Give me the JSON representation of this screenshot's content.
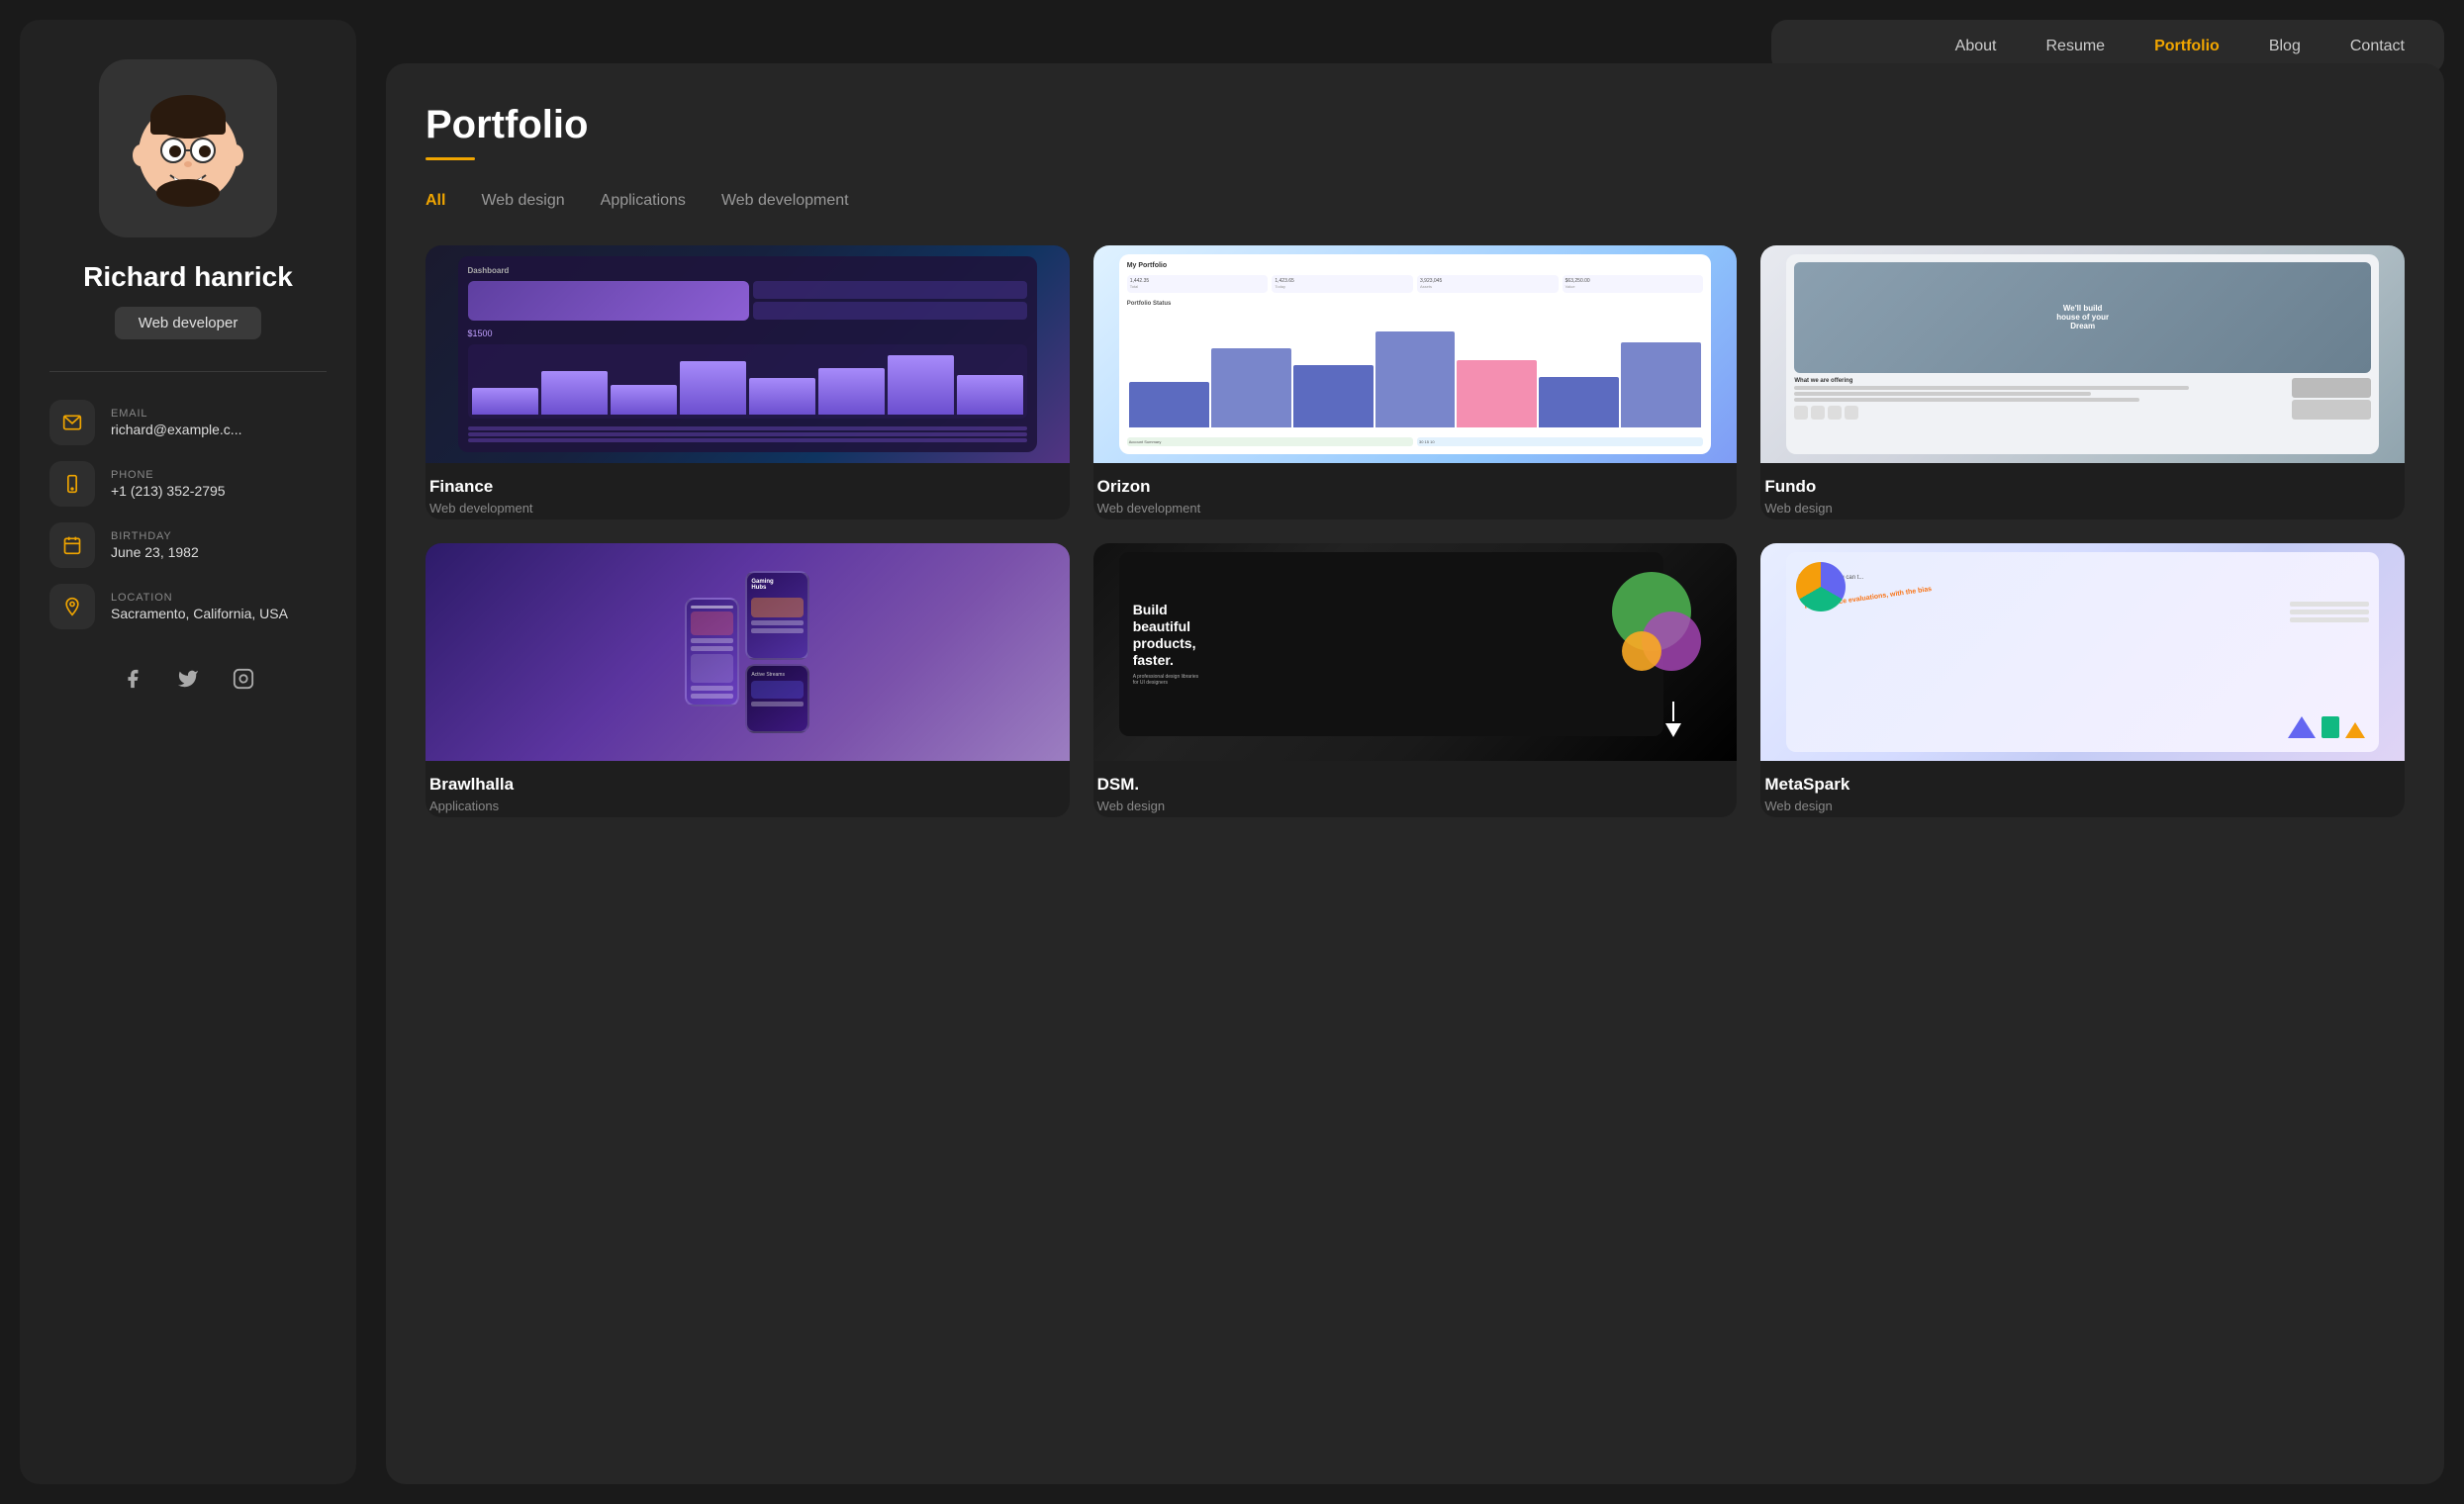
{
  "sidebar": {
    "name": "Richard hanrick",
    "role": "Web developer",
    "avatar_emoji": "🧑‍💻",
    "contacts": [
      {
        "label": "EMAIL",
        "value": "richard@example.c...",
        "icon": "email"
      },
      {
        "label": "PHONE",
        "value": "+1 (213) 352-2795",
        "icon": "phone"
      },
      {
        "label": "BIRTHDAY",
        "value": "June 23, 1982",
        "icon": "calendar"
      },
      {
        "label": "LOCATION",
        "value": "Sacramento, California, USA",
        "icon": "location"
      }
    ],
    "socials": [
      "facebook",
      "twitter",
      "instagram"
    ]
  },
  "nav": {
    "items": [
      {
        "label": "About",
        "active": false
      },
      {
        "label": "Resume",
        "active": false
      },
      {
        "label": "Portfolio",
        "active": true
      },
      {
        "label": "Blog",
        "active": false
      },
      {
        "label": "Contact",
        "active": false
      }
    ]
  },
  "portfolio": {
    "title": "Portfolio",
    "filter_tabs": [
      {
        "label": "All",
        "active": true
      },
      {
        "label": "Web design",
        "active": false
      },
      {
        "label": "Applications",
        "active": false
      },
      {
        "label": "Web development",
        "active": false
      }
    ],
    "projects": [
      {
        "title": "Finance",
        "category": "Web development",
        "img_class": "img-finance"
      },
      {
        "title": "Orizon",
        "category": "Web development",
        "img_class": "img-orizon"
      },
      {
        "title": "Fundo",
        "category": "Web design",
        "img_class": "img-fundo"
      },
      {
        "title": "Brawlhalla",
        "category": "Applications",
        "img_class": "img-brawlhalla"
      },
      {
        "title": "DSM.",
        "category": "Web design",
        "img_class": "img-dsm"
      },
      {
        "title": "MetaSpark",
        "category": "Web design",
        "img_class": "img-metaspark"
      }
    ]
  }
}
